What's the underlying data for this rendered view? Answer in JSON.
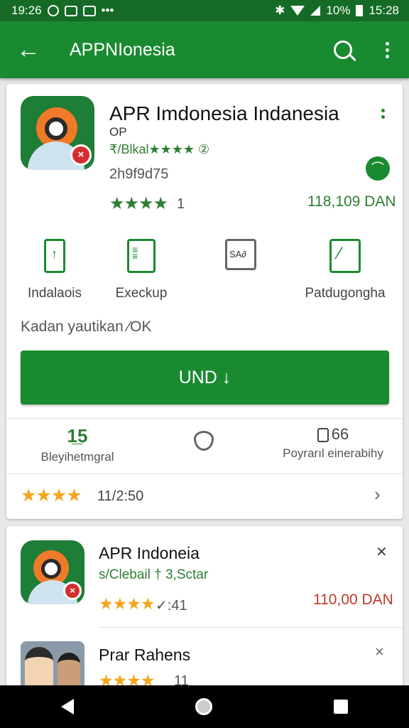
{
  "status_bar": {
    "time_left": "19:26",
    "battery_pct": "10%",
    "time_right": "15:28"
  },
  "app_bar": {
    "title": "APPNIonesia",
    "back_icon": "arrow-left-icon",
    "search_icon": "search-icon",
    "more_icon": "more-vert-icon"
  },
  "app": {
    "name": "APR Imdonesia Indanesia",
    "subtitle": "OP",
    "developer": "₹/Blkal★★★★ ②",
    "meta": "2h9f9d75",
    "rating_stars": "★★★★",
    "rating_count": "1",
    "price": "118,109 DAN"
  },
  "features": [
    {
      "label": "Indalaois",
      "icon": "phone-icon"
    },
    {
      "label": "Execkup",
      "icon": "document-icon"
    },
    {
      "label": "",
      "icon": "sad-card-icon",
      "icon_text": "SA∂"
    },
    {
      "label": "Patdugongha",
      "icon": "edit-icon"
    }
  ],
  "description": "Kadan yautikan ⁄OK",
  "install_label": "UND ↓",
  "stats": {
    "left_value": "1̲5",
    "left_label": "Bleyihetmgral",
    "middle_icon": "shield-icon",
    "right_value": "66",
    "right_label": "Poyrarıl einerabihy"
  },
  "reviews_row": {
    "stars": "★★★★",
    "text": "11/2:50"
  },
  "list": [
    {
      "name": "APR Indoneia",
      "developer": "s/Clebail † 3,Sctar",
      "stars": "★★★★",
      "count": "✓:41",
      "price": "110,00 DAN",
      "action_icon": "shuffle-icon"
    },
    {
      "name": "Prar Rahens",
      "stars": "★★★★",
      "count": "11",
      "action_icon": "close-icon"
    }
  ],
  "colors": {
    "primary": "#1a8a31",
    "status": "#156b26",
    "price_red": "#c0392b",
    "star_orange": "#f4a51c"
  }
}
